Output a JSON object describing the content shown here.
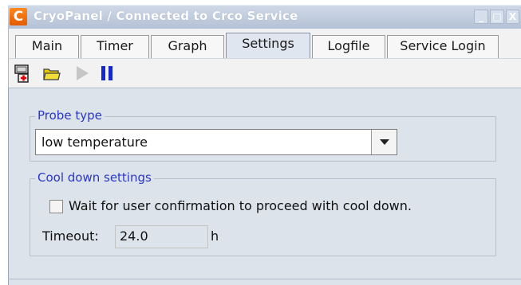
{
  "window": {
    "app_letter": "C",
    "title": "CryoPanel / Connected to Crco Service",
    "minimize_glyph": "_",
    "maximize_glyph": "□",
    "close_glyph": "X"
  },
  "tabs": [
    {
      "label": "Main"
    },
    {
      "label": "Timer"
    },
    {
      "label": "Graph"
    },
    {
      "label": "Settings"
    },
    {
      "label": "Logfile"
    },
    {
      "label": "Service Login"
    }
  ],
  "active_tab": "Settings",
  "toolbar": {
    "icons": [
      "exit-icon",
      "folder-icon",
      "play-icon",
      "pause-icon"
    ],
    "play_enabled": false
  },
  "probe_type": {
    "group_title": "Probe type",
    "selected": "low temperature"
  },
  "cool_down": {
    "group_title": "Cool down settings",
    "wait_label": "Wait for user confirmation to proceed with cool down.",
    "wait_checked": false,
    "timeout_label": "Timeout:",
    "timeout_value": "24.0",
    "timeout_unit": "h"
  },
  "colors": {
    "titlebar": "#b4c2d6",
    "panel_background": "#dde3eb",
    "group_title": "#2a36c8",
    "pause_icon": "#1428d2",
    "app_icon": "#e35a00"
  }
}
